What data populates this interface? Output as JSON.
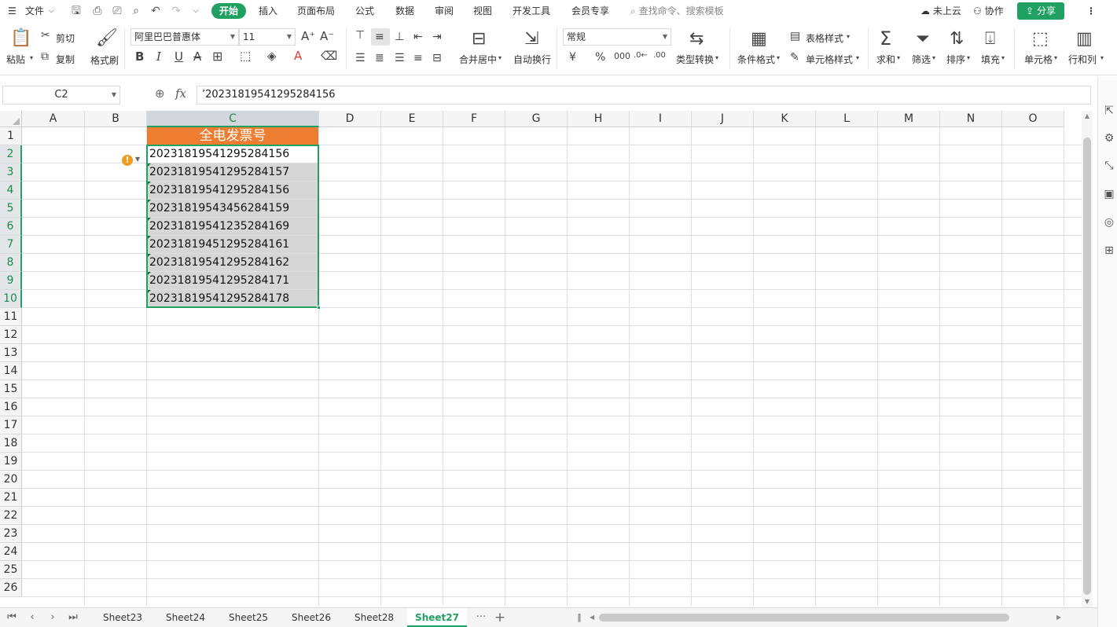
{
  "menu": {
    "file": "文件",
    "tabs": [
      "开始",
      "插入",
      "页面布局",
      "公式",
      "数据",
      "审阅",
      "视图",
      "开发工具",
      "会员专享"
    ],
    "search_placeholder": "查找命令、搜索模板",
    "cloud": "未上云",
    "collab": "协作",
    "share": "分享"
  },
  "ribbon": {
    "paste": "粘贴",
    "cut": "剪切",
    "copy": "复制",
    "format_painter": "格式刷",
    "font_name": "阿里巴巴普惠体",
    "font_size": "11",
    "merge_center": "合并居中",
    "wrap_text": "自动换行",
    "number_format": "常规",
    "type_convert": "类型转换",
    "cond_format": "条件格式",
    "table_style": "表格样式",
    "cell_style": "单元格样式",
    "sum": "求和",
    "filter": "筛选",
    "sort": "排序",
    "fill": "填充",
    "cell": "单元格",
    "rowcol": "行和列"
  },
  "formula_bar": {
    "name_box": "C2",
    "fx": "fx",
    "content": "’20231819541295284156"
  },
  "sheet": {
    "columns": [
      "A",
      "B",
      "C",
      "D",
      "E",
      "F",
      "G",
      "H",
      "I",
      "J",
      "K",
      "L",
      "M",
      "N",
      "O"
    ],
    "rows": [
      "1",
      "2",
      "3",
      "4",
      "5",
      "6",
      "7",
      "8",
      "9",
      "10",
      "11",
      "12",
      "13",
      "14",
      "15",
      "16",
      "17",
      "18",
      "19",
      "20",
      "21",
      "22",
      "23",
      "24",
      "25",
      "26"
    ],
    "header_cell": "全电发票号",
    "invoice_numbers": [
      "20231819541295284156",
      "20231819541295284157",
      "20231819541295284156",
      "20231819543456284159",
      "20231819541235284169",
      "20231819451295284161",
      "20231819541295284162",
      "20231819541295284171",
      "20231819541295284178"
    ],
    "header_color": "#ed7d31",
    "selection_color": "#20a162"
  },
  "sheet_tabs": [
    "Sheet23",
    "Sheet24",
    "Sheet25",
    "Sheet26",
    "Sheet28",
    "Sheet27"
  ],
  "active_sheet": "Sheet27",
  "more_sheets": "···",
  "add_sheet": "+"
}
